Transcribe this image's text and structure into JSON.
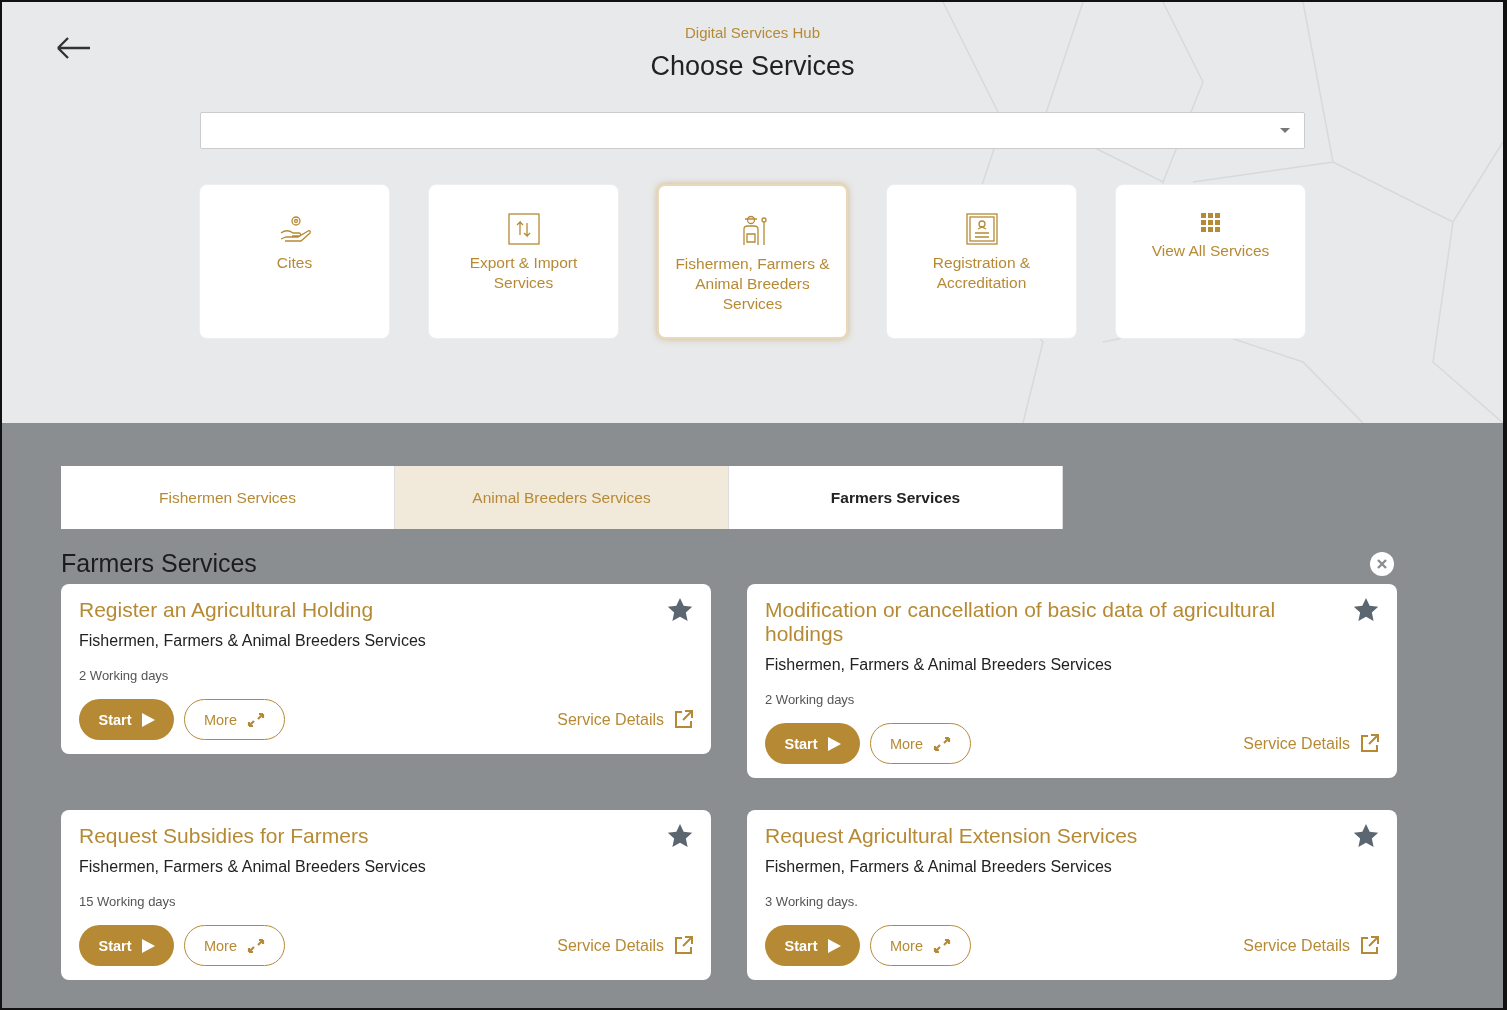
{
  "header": {
    "subtitle": "Digital Services Hub",
    "title": "Choose Services"
  },
  "categories": [
    {
      "kind": "hand",
      "label": "Cites",
      "selected": false
    },
    {
      "kind": "exchange",
      "label": "Export & Import Services",
      "selected": false
    },
    {
      "kind": "farmer",
      "label": "Fishermen, Farmers & Animal Breeders Services",
      "selected": true
    },
    {
      "kind": "certificate",
      "label": "Registration & Accreditation",
      "selected": false
    },
    {
      "kind": "grid",
      "label": "View All Services",
      "selected": false
    }
  ],
  "tabs": [
    {
      "label": "Fishermen Services",
      "selected": false,
      "highlighted": false
    },
    {
      "label": "Animal Breeders Services",
      "selected": false,
      "highlighted": true
    },
    {
      "label": "Farmers Services",
      "selected": true,
      "highlighted": false
    }
  ],
  "section_title": "Farmers Services",
  "services": [
    {
      "title": "Register an Agricultural Holding",
      "category": "Fishermen, Farmers & Animal Breeders Services",
      "duration": "2 Working days",
      "start": "Start",
      "more": "More",
      "details": "Service Details"
    },
    {
      "title": "Modification or cancellation of basic data of agricultural holdings",
      "category": "Fishermen, Farmers & Animal Breeders Services",
      "duration": "2 Working days",
      "start": "Start",
      "more": "More",
      "details": "Service Details"
    },
    {
      "title": "Request Subsidies for Farmers",
      "category": "Fishermen, Farmers & Animal Breeders Services",
      "duration": "15 Working days",
      "start": "Start",
      "more": "More",
      "details": "Service Details"
    },
    {
      "title": "Request Agricultural Extension Services",
      "category": "Fishermen, Farmers & Animal Breeders Services",
      "duration": "3 Working days.",
      "start": "Start",
      "more": "More",
      "details": "Service Details"
    }
  ]
}
